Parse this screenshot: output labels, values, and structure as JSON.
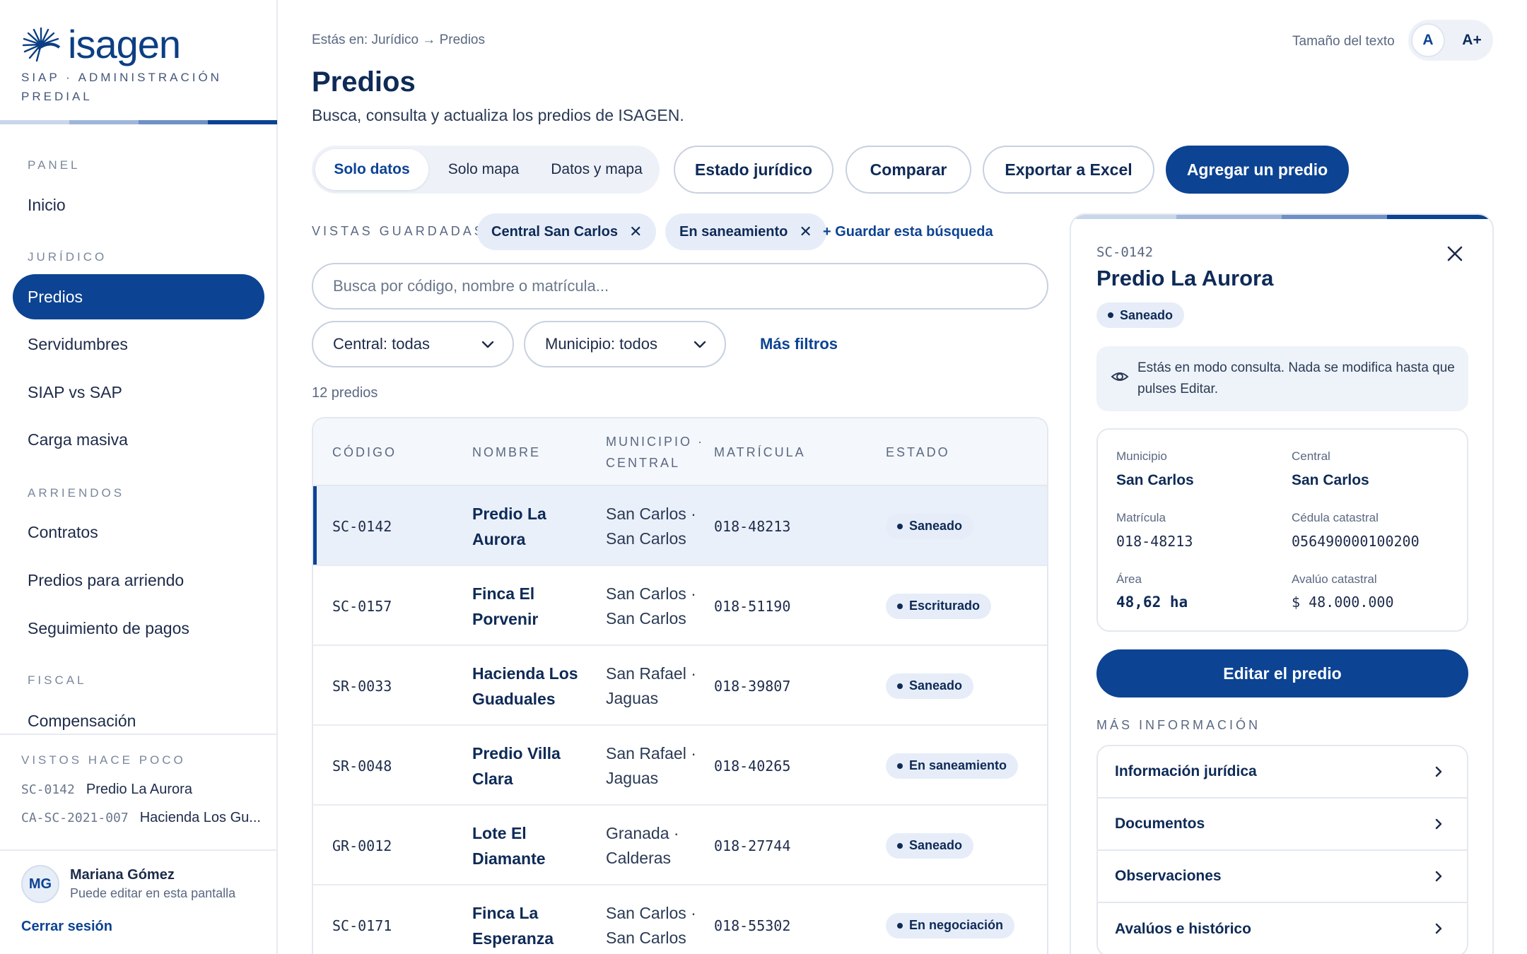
{
  "colors": {
    "brand": "#0c4393",
    "brand_dark": "#0e2a57",
    "accent_light": "#e6edf8",
    "bar_1": "#c9d6ea",
    "bar_2": "#9fb6da",
    "bar_3": "#6e90c6",
    "bar_4": "#0c4393"
  },
  "sidebar": {
    "logo_text": "isagen",
    "logo_icon": "isagen-sunburst-icon",
    "subtitle": "SIAP · ADMINISTRACIÓN PREDIAL",
    "sections": [
      {
        "title": "PANEL",
        "items": [
          {
            "label": "Inicio",
            "active": false
          }
        ]
      },
      {
        "title": "JURÍDICO",
        "items": [
          {
            "label": "Predios",
            "active": true
          },
          {
            "label": "Servidumbres",
            "active": false
          },
          {
            "label": "SIAP vs SAP",
            "active": false
          },
          {
            "label": "Carga masiva",
            "active": false
          }
        ]
      },
      {
        "title": "ARRIENDOS",
        "items": [
          {
            "label": "Contratos",
            "active": false
          },
          {
            "label": "Predios para arriendo",
            "active": false
          },
          {
            "label": "Seguimiento de pagos",
            "active": false
          }
        ]
      },
      {
        "title": "FISCAL",
        "items": [
          {
            "label": "Compensación",
            "active": false
          }
        ]
      }
    ],
    "recent": {
      "title": "VISTOS HACE POCO",
      "items": [
        {
          "code": "SC-0142",
          "name": "Predio La Aurora"
        },
        {
          "code": "CA-SC-2021-007",
          "name": "Hacienda Los Gu..."
        }
      ]
    },
    "user": {
      "initials": "MG",
      "name": "Mariana Gómez",
      "role": "Puede editar en esta pantalla",
      "logout": "Cerrar sesión"
    }
  },
  "header": {
    "breadcrumb": "Estás en: Jurídico → Predios",
    "title": "Predios",
    "subtitle": "Busca, consulta y actualiza los predios de ISAGEN.",
    "text_size_label": "Tamaño del texto",
    "text_size_options": [
      "A",
      "A+"
    ]
  },
  "toolbar": {
    "view_modes": [
      {
        "label": "Solo datos",
        "active": true
      },
      {
        "label": "Solo mapa",
        "active": false
      },
      {
        "label": "Datos y mapa",
        "active": false
      }
    ],
    "legal_status": "Estado jurídico",
    "compare": "Comparar",
    "export": "Exportar a Excel",
    "add": "Agregar un predio"
  },
  "saved_views": {
    "label": "VISTAS GUARDADAS",
    "chips": [
      "Central San Carlos",
      "En saneamiento"
    ],
    "save_link": "+ Guardar esta búsqueda"
  },
  "search": {
    "placeholder": "Busca por código, nombre o matrícula..."
  },
  "filters": {
    "central": "Central: todas",
    "municipio": "Municipio: todos",
    "more": "Más filtros"
  },
  "results_count": "12 predios",
  "table": {
    "headers": {
      "code": "CÓDIGO",
      "name": "NOMBRE",
      "muni_1": "MUNICIPIO ·",
      "muni_2": "CENTRAL",
      "matricula": "MATRÍCULA",
      "state": "ESTADO"
    },
    "rows": [
      {
        "code": "SC-0142",
        "name_1": "Predio La",
        "name_2": "Aurora",
        "muni_1": "San Carlos ·",
        "muni_2": "San Carlos",
        "matricula": "018-48213",
        "state": "Saneado",
        "selected": true
      },
      {
        "code": "SC-0157",
        "name_1": "Finca El",
        "name_2": "Porvenir",
        "muni_1": "San Carlos ·",
        "muni_2": "San Carlos",
        "matricula": "018-51190",
        "state": "Escriturado",
        "selected": false
      },
      {
        "code": "SR-0033",
        "name_1": "Hacienda Los",
        "name_2": "Guaduales",
        "muni_1": "San Rafael ·",
        "muni_2": "Jaguas",
        "matricula": "018-39807",
        "state": "Saneado",
        "selected": false
      },
      {
        "code": "SR-0048",
        "name_1": "Predio Villa",
        "name_2": "Clara",
        "muni_1": "San Rafael ·",
        "muni_2": "Jaguas",
        "matricula": "018-40265",
        "state": "En saneamiento",
        "selected": false
      },
      {
        "code": "GR-0012",
        "name_1": "Lote El",
        "name_2": "Diamante",
        "muni_1": "Granada ·",
        "muni_2": "Calderas",
        "matricula": "018-27744",
        "state": "Saneado",
        "selected": false
      },
      {
        "code": "SC-0171",
        "name_1": "Finca La",
        "name_2": "Esperanza",
        "muni_1": "San Carlos ·",
        "muni_2": "San Carlos",
        "matricula": "018-55302",
        "state": "En negociación",
        "selected": false
      }
    ]
  },
  "detail": {
    "code": "SC-0142",
    "title": "Predio La Aurora",
    "state": "Saneado",
    "notice": "Estás en modo consulta. Nada se modifica hasta que pulses Editar.",
    "facts": {
      "municipio_label": "Municipio",
      "municipio": "San Carlos",
      "central_label": "Central",
      "central": "San Carlos",
      "matricula_label": "Matrícula",
      "matricula": "018-48213",
      "cedula_label": "Cédula catastral",
      "cedula": "056490000100200",
      "area_label": "Área",
      "area": "48,62 ha",
      "avaluo_label": "Avalúo catastral",
      "avaluo": "$ 48.000.000"
    },
    "edit_button": "Editar el predio",
    "more_title": "MÁS INFORMACIÓN",
    "more_items": [
      "Información jurídica",
      "Documentos",
      "Observaciones",
      "Avalúos e histórico"
    ]
  }
}
